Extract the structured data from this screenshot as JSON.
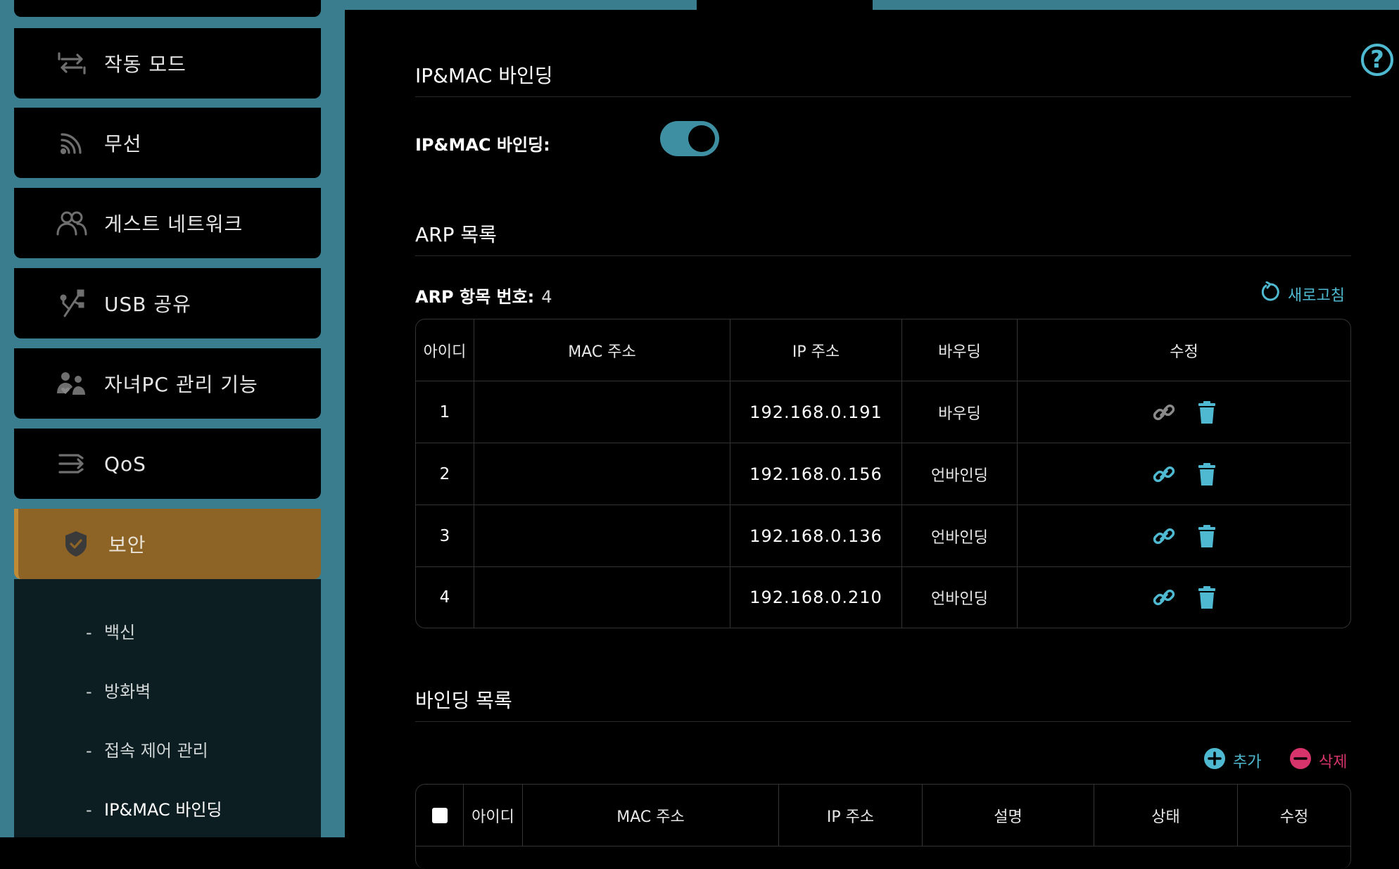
{
  "sidebar": {
    "items": [
      {
        "label": "작동 모드",
        "icon": "operation-mode-icon"
      },
      {
        "label": "무선",
        "icon": "wireless-icon"
      },
      {
        "label": "게스트 네트워크",
        "icon": "guest-network-icon"
      },
      {
        "label": "USB 공유",
        "icon": "usb-icon"
      },
      {
        "label": "자녀PC 관리 기능",
        "icon": "parental-control-icon"
      },
      {
        "label": "QoS",
        "icon": "qos-icon"
      },
      {
        "label": "보안",
        "icon": "security-shield-icon",
        "active": true
      }
    ],
    "submenu": [
      {
        "label": "백신"
      },
      {
        "label": "방화벽"
      },
      {
        "label": "접속 제어 관리"
      },
      {
        "label": "IP&MAC 바인딩",
        "current": true
      }
    ]
  },
  "main": {
    "binding_section_title": "IP&MAC 바인딩",
    "binding_field_label": "IP&MAC 바인딩:",
    "binding_enabled": true,
    "arp_section_title": "ARP 목록",
    "arp_count_label": "ARP 항목 번호:",
    "arp_count_value": "4",
    "refresh_label": "새로고침",
    "arp_table": {
      "headers": [
        "아이디",
        "MAC 주소",
        "IP 주소",
        "바우딩",
        "수정"
      ],
      "rows": [
        {
          "id": "1",
          "mac": "",
          "ip": "192.168.0.191",
          "status": "바우딩"
        },
        {
          "id": "2",
          "mac": "",
          "ip": "192.168.0.156",
          "status": "언바인딩"
        },
        {
          "id": "3",
          "mac": "",
          "ip": "192.168.0.136",
          "status": "언바인딩"
        },
        {
          "id": "4",
          "mac": "",
          "ip": "192.168.0.210",
          "status": "언바인딩"
        }
      ]
    },
    "binding_list_title": "바인딩 목록",
    "add_label": "추가",
    "delete_label": "삭제",
    "binding_table": {
      "headers": [
        "아이디",
        "MAC 주소",
        "IP 주소",
        "설명",
        "상태",
        "수정"
      ]
    }
  },
  "colors": {
    "accent": "#4fb9d1",
    "frame": "#397d8f",
    "active_nav": "#8d6426",
    "delete": "#d6346b"
  }
}
